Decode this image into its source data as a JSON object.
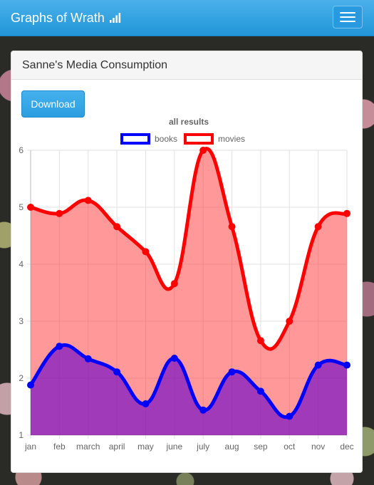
{
  "navbar": {
    "brand": "Graphs of Wrath",
    "brand_icon": "signal-bars-icon",
    "menu_icon": "hamburger-menu-icon"
  },
  "panel": {
    "title": "Sanne's Media Consumption",
    "download_label": "Download"
  },
  "colors": {
    "navbar": "#2196d8",
    "books_line": "#0000ff",
    "movies_line": "#ff0000",
    "books_fill": "rgba(102,0,204,0.62)",
    "movies_fill": "rgba(255,50,50,0.5)"
  },
  "chart_data": {
    "type": "line",
    "title": "all results",
    "categories": [
      "jan",
      "feb",
      "march",
      "april",
      "may",
      "june",
      "july",
      "aug",
      "sep",
      "oct",
      "nov",
      "dec"
    ],
    "series": [
      {
        "name": "books",
        "values": [
          1.88,
          2.56,
          2.34,
          2.11,
          1.55,
          2.35,
          1.44,
          2.11,
          1.77,
          1.33,
          2.23,
          2.23
        ]
      },
      {
        "name": "movies",
        "values": [
          5.0,
          4.89,
          5.12,
          4.66,
          4.22,
          3.66,
          6.0,
          4.66,
          2.66,
          3.0,
          4.66,
          4.89
        ]
      }
    ],
    "ylim": [
      1,
      6
    ],
    "yticks": [
      1,
      2,
      3,
      4,
      5,
      6
    ],
    "xlabel": "",
    "ylabel": "",
    "grid": true,
    "legend": "top-center",
    "smooth": true,
    "filled": true
  }
}
